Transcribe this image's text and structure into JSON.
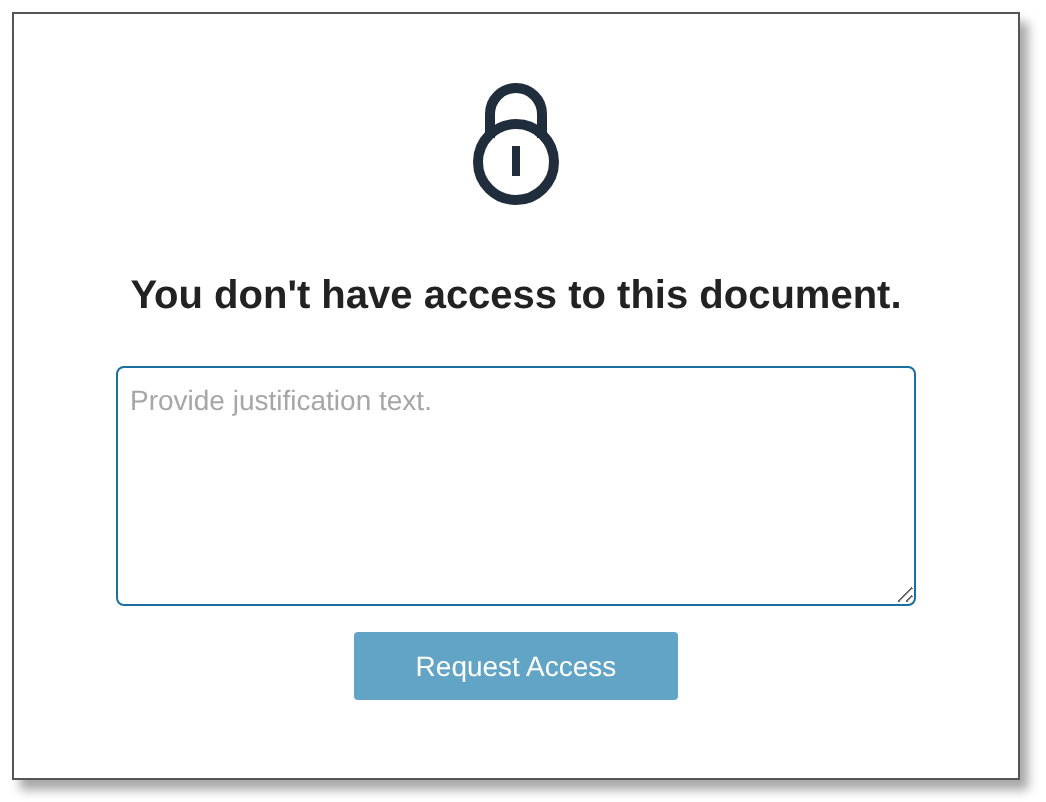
{
  "heading": "You don't have access to this document.",
  "justification": {
    "placeholder": "Provide justification text."
  },
  "request_button": {
    "label": "Request Access",
    "disabled": true
  }
}
